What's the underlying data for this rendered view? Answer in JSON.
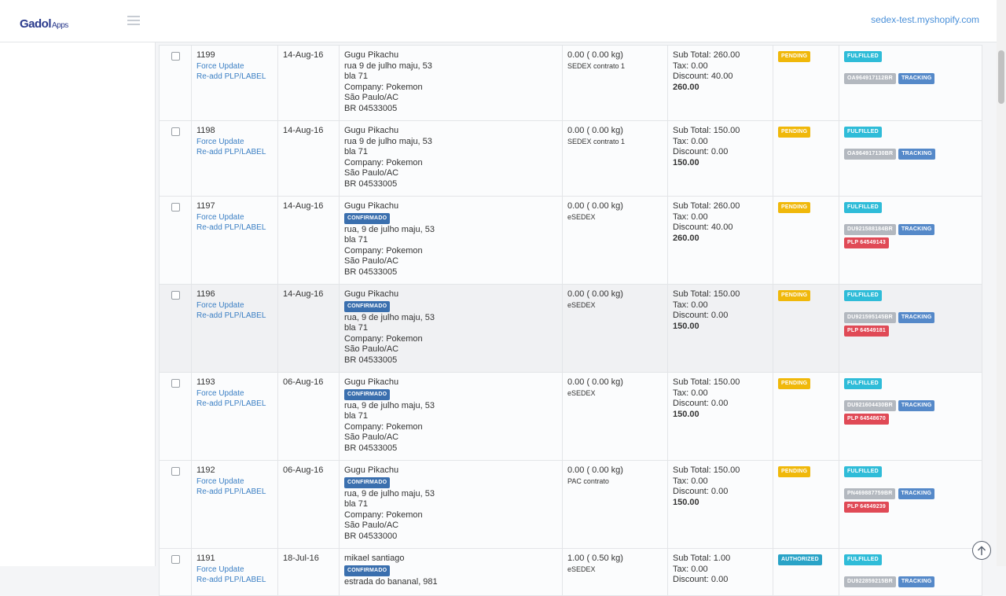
{
  "header": {
    "logo_main": "Gadol",
    "logo_sub": "Apps",
    "shop": "sedex-test.myshopify.com"
  },
  "orders": [
    {
      "id": "1199",
      "date": "14-Aug-16",
      "name": "Gugu Pikachu",
      "confirmed": false,
      "address": [
        "rua 9 de julho maju, 53",
        "bla 71",
        "Company: Pokemon",
        "São Paulo/AC",
        "BR 04533005"
      ],
      "weight": "0.00 ( 0.00 kg)",
      "service": "SEDEX contrato 1",
      "subtotal": "Sub Total: 260.00",
      "tax": "Tax: 0.00",
      "discount": "Discount: 40.00",
      "total": "260.00",
      "status": "PENDING",
      "fulfillment": "FULFILLED",
      "tracking_number": "OA964917112BR",
      "plp": null
    },
    {
      "id": "1198",
      "date": "14-Aug-16",
      "name": "Gugu Pikachu",
      "confirmed": false,
      "address": [
        "rua 9 de julho maju, 53",
        "bla 71",
        "Company: Pokemon",
        "São Paulo/AC",
        "BR 04533005"
      ],
      "weight": "0.00 ( 0.00 kg)",
      "service": "SEDEX contrato 1",
      "subtotal": "Sub Total: 150.00",
      "tax": "Tax: 0.00",
      "discount": "Discount: 0.00",
      "total": "150.00",
      "status": "PENDING",
      "fulfillment": "FULFILLED",
      "tracking_number": "OA964917130BR",
      "plp": null
    },
    {
      "id": "1197",
      "date": "14-Aug-16",
      "name": "Gugu Pikachu",
      "confirmed": true,
      "address": [
        "rua, 9 de julho maju, 53",
        "bla 71",
        "Company: Pokemon",
        "São Paulo/AC",
        "BR 04533005"
      ],
      "weight": "0.00 ( 0.00 kg)",
      "service": "eSEDEX",
      "subtotal": "Sub Total: 260.00",
      "tax": "Tax: 0.00",
      "discount": "Discount: 40.00",
      "total": "260.00",
      "status": "PENDING",
      "fulfillment": "FULFILLED",
      "tracking_number": "DU921588184BR",
      "plp": "PLP 64549143"
    },
    {
      "id": "1196",
      "date": "14-Aug-16",
      "name": "Gugu Pikachu",
      "confirmed": true,
      "address": [
        "rua, 9 de julho maju, 53",
        "bla 71",
        "Company: Pokemon",
        "São Paulo/AC",
        "BR 04533005"
      ],
      "weight": "0.00 ( 0.00 kg)",
      "service": "eSEDEX",
      "subtotal": "Sub Total: 150.00",
      "tax": "Tax: 0.00",
      "discount": "Discount: 0.00",
      "total": "150.00",
      "status": "PENDING",
      "fulfillment": "FULFILLED",
      "tracking_number": "DU921595145BR",
      "plp": "PLP 64549181"
    },
    {
      "id": "1193",
      "date": "06-Aug-16",
      "name": "Gugu Pikachu",
      "confirmed": true,
      "address": [
        "rua, 9 de julho maju, 53",
        "bla 71",
        "Company: Pokemon",
        "São Paulo/AC",
        "BR 04533005"
      ],
      "weight": "0.00 ( 0.00 kg)",
      "service": "eSEDEX",
      "subtotal": "Sub Total: 150.00",
      "tax": "Tax: 0.00",
      "discount": "Discount: 0.00",
      "total": "150.00",
      "status": "PENDING",
      "fulfillment": "FULFILLED",
      "tracking_number": "DU921604430BR",
      "plp": "PLP 64548670"
    },
    {
      "id": "1192",
      "date": "06-Aug-16",
      "name": "Gugu Pikachu",
      "confirmed": true,
      "address": [
        "rua, 9 de julho maju, 53",
        "bla 71",
        "Company: Pokemon",
        "São Paulo/AC",
        "BR 04533000"
      ],
      "weight": "0.00 ( 0.00 kg)",
      "service": "PAC contrato",
      "subtotal": "Sub Total: 150.00",
      "tax": "Tax: 0.00",
      "discount": "Discount: 0.00",
      "total": "150.00",
      "status": "PENDING",
      "fulfillment": "FULFILLED",
      "tracking_number": "PN469887759BR",
      "plp": "PLP 64549239"
    },
    {
      "id": "1191",
      "date": "18-Jul-16",
      "name": "mikael santiago",
      "confirmed": true,
      "address": [
        "estrada do bananal, 981"
      ],
      "weight": "1.00 ( 0.50 kg)",
      "service": "eSEDEX",
      "subtotal": "Sub Total: 1.00",
      "tax": "Tax: 0.00",
      "discount": "Discount: 0.00",
      "total": "",
      "status": "AUTHORIZED",
      "fulfillment": "FULFILLED",
      "tracking_number": "DU922859215BR",
      "plp": null
    }
  ],
  "labels": {
    "force_update": "Force Update",
    "readd": "Re-add PLP/LABEL",
    "confirmed": "CONFIRMADO",
    "tracking": "TRACKING"
  },
  "colors": {
    "pending": "#f0b80a",
    "authorized": "#29a3c7",
    "fulfilled": "#2fbcd8",
    "tracking": "#5589c9",
    "plp": "#e04a56",
    "confirmed": "#3a6fae"
  },
  "icons": {
    "menu": "hamburger-icon",
    "scroll_top": "arrow-up-circle-icon"
  }
}
